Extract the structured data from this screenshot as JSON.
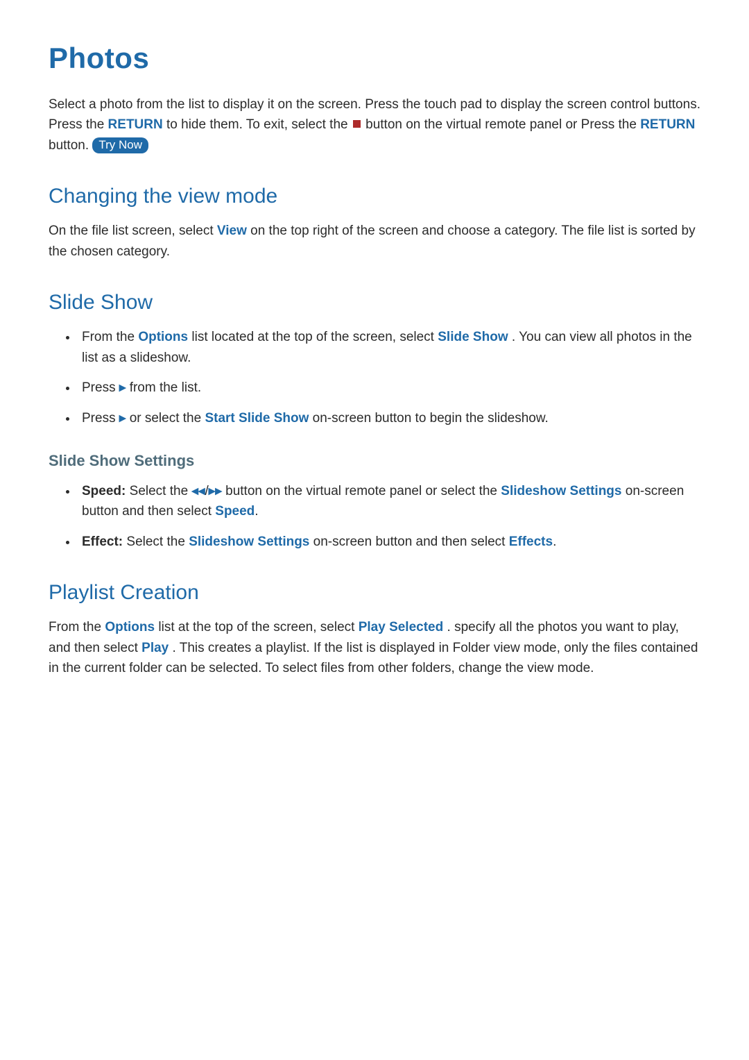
{
  "colors": {
    "accent": "#1f6aa8",
    "muted": "#4f6c7a",
    "text": "#2b2b2b",
    "stop": "#ad2a2a"
  },
  "title": "Photos",
  "intro": {
    "t1": "Select a photo from the list to display it on the screen. Press the touch pad to display the screen control buttons. Press the ",
    "k1": "RETURN",
    "t2": " to hide them. To exit, select the ",
    "t3": " button on the virtual remote panel or Press the ",
    "k2": "RETURN",
    "t4": " button. "
  },
  "try_now": "Try Now",
  "s1": {
    "heading": "Changing the view mode",
    "p_t1": "On the file list screen, select ",
    "p_k1": "View",
    "p_t2": " on the top right of the screen and choose a category. The file list is sorted by the chosen category."
  },
  "s2": {
    "heading": "Slide Show",
    "li1_t1": "From the ",
    "li1_k1": "Options",
    "li1_t2": " list located at the top of the screen, select ",
    "li1_k2": "Slide Show",
    "li1_t3": ". You can view all photos in the list as a slideshow.",
    "li2_t1": "Press ",
    "li2_g1": "▸",
    "li2_t2": " from the list.",
    "li3_t1": "Press ",
    "li3_g1": "▸",
    "li3_t2": " or select the ",
    "li3_k1": "Start Slide Show",
    "li3_t3": " on-screen button to begin the slideshow."
  },
  "s2_sub": {
    "heading": "Slide Show Settings",
    "li1_lbl": "Speed:",
    "li1_t1": " Select the ",
    "li1_g1": "◂◂",
    "li1_sep": "/",
    "li1_g2": "▸▸",
    "li1_t2": " button on the virtual remote panel or select the ",
    "li1_k1": "Slideshow Settings",
    "li1_t3": " on-screen button and then select ",
    "li1_k2": "Speed",
    "li1_t4": ".",
    "li2_lbl": "Effect:",
    "li2_t1": " Select the ",
    "li2_k1": "Slideshow Settings",
    "li2_t2": " on-screen button and then select ",
    "li2_k2": "Effects",
    "li2_t3": "."
  },
  "s3": {
    "heading": "Playlist Creation",
    "p_t1": "From the ",
    "p_k1": "Options",
    "p_t2": " list at the top of the screen, select ",
    "p_k2": "Play Selected",
    "p_t3": ". specify all the photos you want to play, and then select ",
    "p_k3": "Play",
    "p_t4": ". This creates a playlist. If the list is displayed in Folder view mode, only the files contained in the current folder can be selected. To select files from other folders, change the view mode."
  }
}
